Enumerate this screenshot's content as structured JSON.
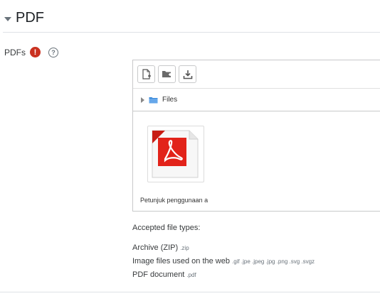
{
  "section": {
    "title": "PDF"
  },
  "field": {
    "label": "PDFs",
    "required_symbol": "!",
    "help_symbol": "?"
  },
  "filemanager": {
    "path_label": "Files",
    "file": {
      "name": "Petunjuk penggunaan a"
    }
  },
  "accepted": {
    "title": "Accepted file types:",
    "types": [
      {
        "name": "Archive (ZIP)",
        "ext": ".zip"
      },
      {
        "name": "Image files used on the web",
        "ext": ".gif .jpe .jpeg .jpg .png .svg .svgz"
      },
      {
        "name": "PDF document",
        "ext": ".pdf"
      }
    ]
  },
  "colors": {
    "required": "#ca3120",
    "pdf_red": "#e2231a",
    "folder_blue": "#3b8ad9"
  },
  "icons": [
    "chevron-down-icon",
    "exclamation-icon",
    "question-icon",
    "add-file-icon",
    "create-folder-icon",
    "download-icon",
    "folder-icon",
    "pdf-file-icon"
  ]
}
